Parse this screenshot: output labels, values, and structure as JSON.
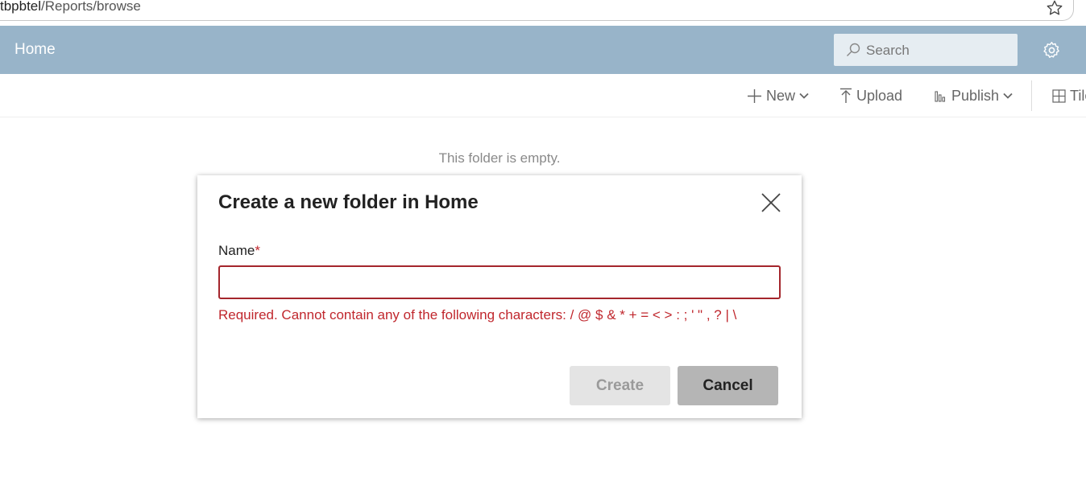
{
  "browser": {
    "url_prefix": "tbpbtel",
    "url_path": "/Reports/browse"
  },
  "header": {
    "title": "Home",
    "search_placeholder": "Search"
  },
  "toolbar": {
    "new_label": "New",
    "upload_label": "Upload",
    "publish_label": "Publish",
    "tiles_label": "Tiles"
  },
  "content": {
    "empty_message": "This folder is empty."
  },
  "dialog": {
    "title": "Create a new folder in Home",
    "name_label": "Name",
    "required_marker": "*",
    "name_value": "",
    "error_message": "Required. Cannot contain any of the following characters: / @ $ & * + = < > : ; ' \" , ? | \\",
    "create_label": "Create",
    "cancel_label": "Cancel"
  },
  "colors": {
    "header_bg": "#98b4c9",
    "error": "#c0272d",
    "input_border": "#a4262c"
  }
}
